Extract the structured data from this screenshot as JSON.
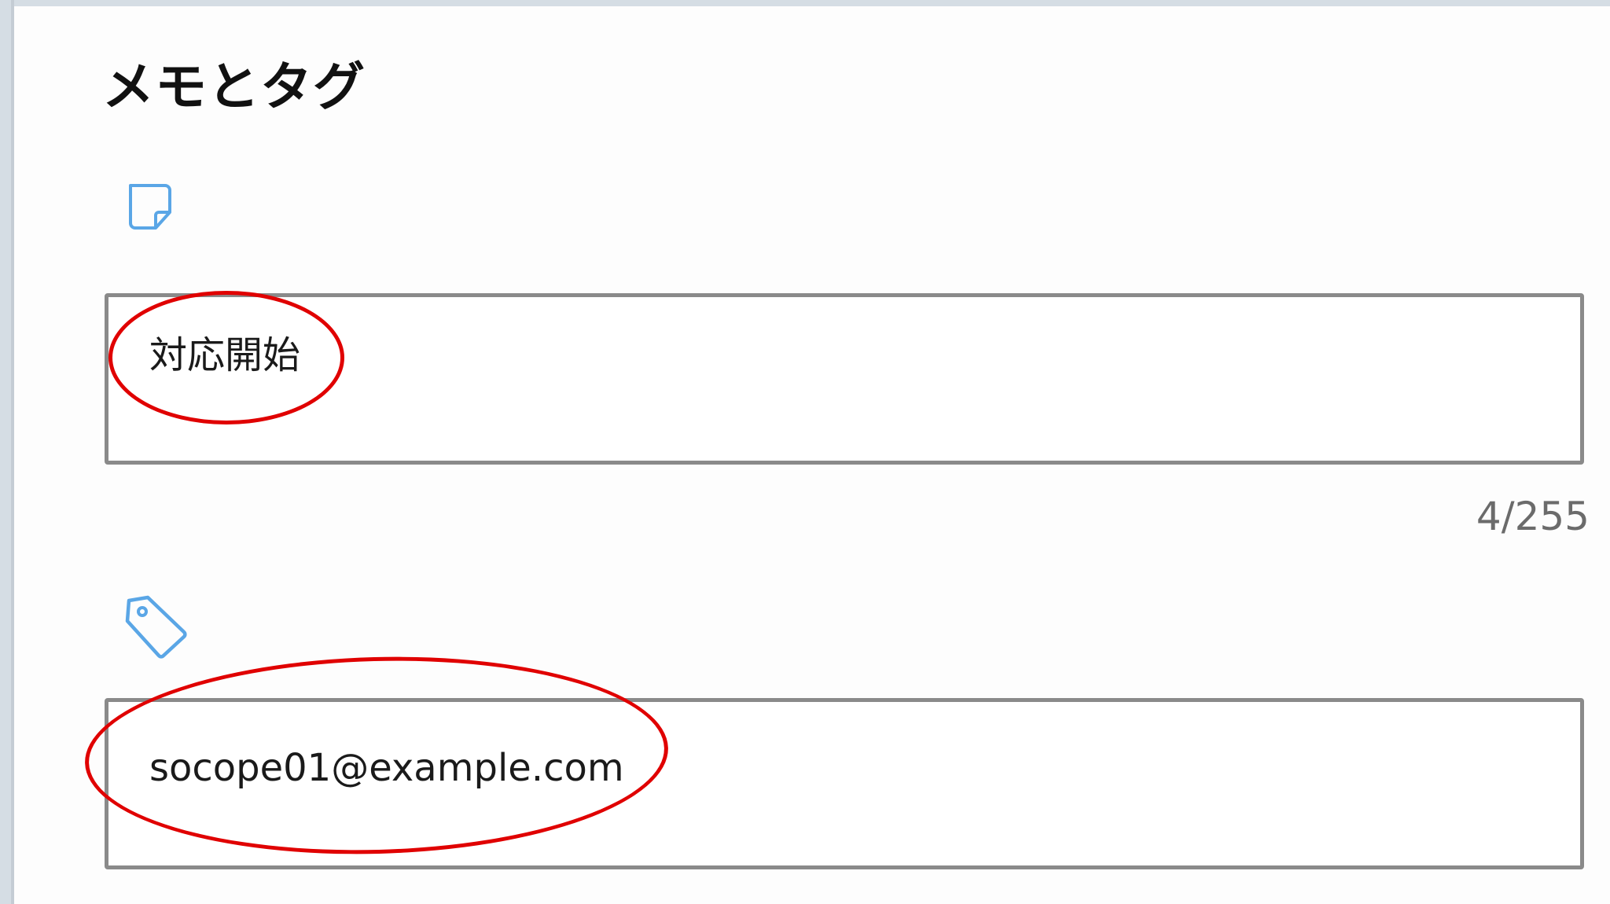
{
  "section": {
    "title": "メモとタグ"
  },
  "memo": {
    "icon": "sticky-note-icon",
    "value": "対応開始",
    "counter": "4/255"
  },
  "tags": {
    "icon": "tag-icon",
    "value": "socope01@example.com"
  },
  "colors": {
    "accent_icon": "#5aa6e6",
    "annotation": "#e00000",
    "field_border": "#8a8a8a"
  }
}
